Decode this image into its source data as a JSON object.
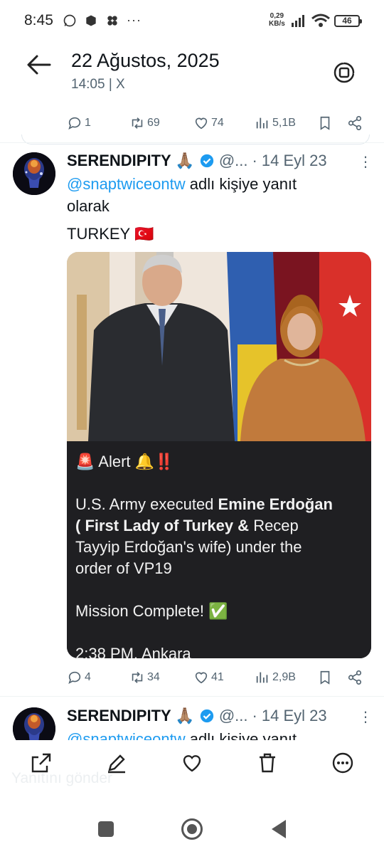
{
  "status_bar": {
    "time": "8:45",
    "net_speed_value": "0,29",
    "net_speed_unit": "KB/s",
    "battery": "46",
    "more": "···"
  },
  "header": {
    "title": "22 Ağustos, 2025",
    "subtitle": "14:05 | X"
  },
  "main_tweet_actions": {
    "replies": "1",
    "retweets": "69",
    "likes": "74",
    "views": "5,1B"
  },
  "reply1": {
    "name": "SERENDIPITY 🙏🏽",
    "handle": "@...",
    "time": "· 14 Eyl 23",
    "reply_to_handle": "@snaptwiceontw",
    "reply_to_suffix": " adlı kişiye yanıt",
    "reply_to_line2": "olarak",
    "text": "TURKEY 🇹🇷",
    "card": {
      "alert_line": "🚨 Alert 🔔‼️",
      "line1_pre": "U.S. Army executed ",
      "line1_bold": "Emine Erdoğan",
      "line2_bold": "( First Lady of Turkey & ",
      "line2_rest": "Recep",
      "line3": "Tayyip Erdoğan's wife) under the",
      "line4": "order of VP19",
      "mission": "Mission Complete! ✅",
      "time_line": "2:38 PM, Ankara"
    },
    "actions": {
      "replies": "4",
      "retweets": "34",
      "likes": "41",
      "views": "2,9B"
    }
  },
  "reply2": {
    "name": "SERENDIPITY 🙏🏽",
    "handle": "@...",
    "time": "· 14 Eyl 23",
    "reply_to_handle": "@snaptwiceontw",
    "reply_to_suffix": " adlı kişiye yanıt"
  },
  "compose": {
    "placeholder": "Yanıtını gönder"
  },
  "colors": {
    "accent": "#1d9bf0",
    "card_bg": "#1f1f22"
  }
}
